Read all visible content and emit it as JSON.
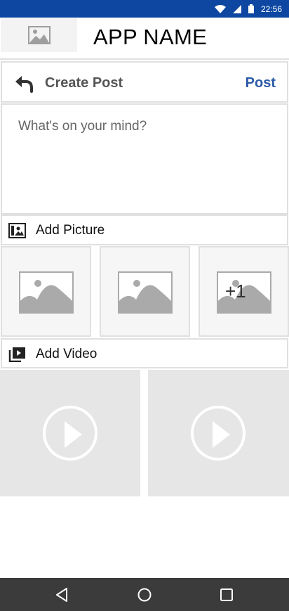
{
  "status": {
    "time": "22:56",
    "icons": [
      "wifi-icon",
      "signal-icon",
      "battery-icon"
    ],
    "bar_color": "#0d47a1"
  },
  "app": {
    "title": "APP NAME",
    "logo_icon": "image-placeholder-icon"
  },
  "create_post": {
    "title": "Create Post",
    "post_label": "Post",
    "back_icon": "back-arrow-icon",
    "accent_color": "#2b5aa8"
  },
  "composer": {
    "placeholder": "What's on your mind?"
  },
  "picture_section": {
    "label": "Add Picture",
    "icon": "add-photo-icon",
    "thumbnails": [
      {
        "icon": "image-placeholder-icon",
        "overlay": ""
      },
      {
        "icon": "image-placeholder-icon",
        "overlay": ""
      },
      {
        "icon": "image-placeholder-icon",
        "overlay": "+1"
      }
    ]
  },
  "video_section": {
    "label": "Add Video",
    "icon": "video-library-icon",
    "videos": [
      {
        "icon": "play-icon"
      },
      {
        "icon": "play-icon"
      }
    ]
  },
  "nav": {
    "buttons": [
      "back-triangle-icon",
      "home-circle-icon",
      "recents-square-icon"
    ]
  }
}
